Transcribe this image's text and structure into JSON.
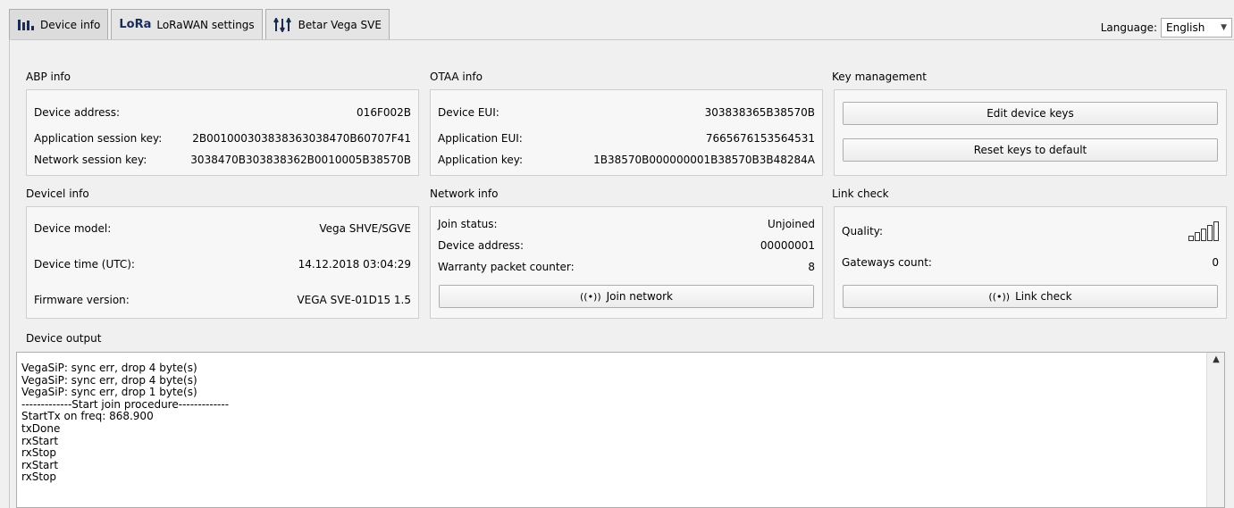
{
  "tabs": [
    {
      "label": "Device info",
      "icon": "bar-chart-icon",
      "active": true
    },
    {
      "brand": "LoRa",
      "label": "LoRaWAN settings",
      "icon": "lora-logo"
    },
    {
      "label": "Betar Vega SVE",
      "icon": "sliders-icon"
    }
  ],
  "language": {
    "label": "Language:",
    "value": "English"
  },
  "abp": {
    "title": "ABP info",
    "rows": [
      {
        "key": "Device address:",
        "value": "016F002B"
      },
      {
        "key": "Application session key:",
        "value": "2B001000303838363038470B60707F41"
      },
      {
        "key": "Network session key:",
        "value": "3038470B303838362B0010005B38570B"
      }
    ]
  },
  "otaa": {
    "title": "OTAA info",
    "rows": [
      {
        "key": "Device EUI:",
        "value": "303838365B38570B"
      },
      {
        "key": "Application EUI:",
        "value": "7665676153564531"
      },
      {
        "key": "Application key:",
        "value": "1B38570B000000001B38570B3B48284A"
      }
    ]
  },
  "keys": {
    "title": "Key management",
    "edit_label": "Edit device keys",
    "reset_label": "Reset keys to default"
  },
  "device": {
    "title": "Devicel info",
    "rows": [
      {
        "key": "Device model:",
        "value": "Vega SHVE/SGVE"
      },
      {
        "key": "Device time (UTC):",
        "value": "14.12.2018 03:04:29"
      },
      {
        "key": "Firmware version:",
        "value": "VEGA SVE-01D15 1.5"
      }
    ]
  },
  "network": {
    "title": "Network info",
    "rows": [
      {
        "key": "Join status:",
        "value": "Unjoined"
      },
      {
        "key": "Device address:",
        "value": "00000001"
      },
      {
        "key": "Warranty packet counter:",
        "value": "8"
      }
    ],
    "join_label": "Join network"
  },
  "link": {
    "title": "Link check",
    "quality_label": "Quality:",
    "gateways_label": "Gateways count:",
    "gateways_value": "0",
    "link_label": "Link check",
    "signal_level": 0
  },
  "output": {
    "title": "Device output",
    "lines": [
      "VegaSiP: sync err, drop 4 byte(s)",
      "VegaSiP: sync err, drop 4 byte(s)",
      "VegaSiP: sync err, drop 1 byte(s)",
      "-------------Start join procedure-------------",
      "StartTx on freq: 868.900",
      "txDone",
      "rxStart",
      "rxStop",
      "rxStart",
      "rxStop"
    ]
  }
}
